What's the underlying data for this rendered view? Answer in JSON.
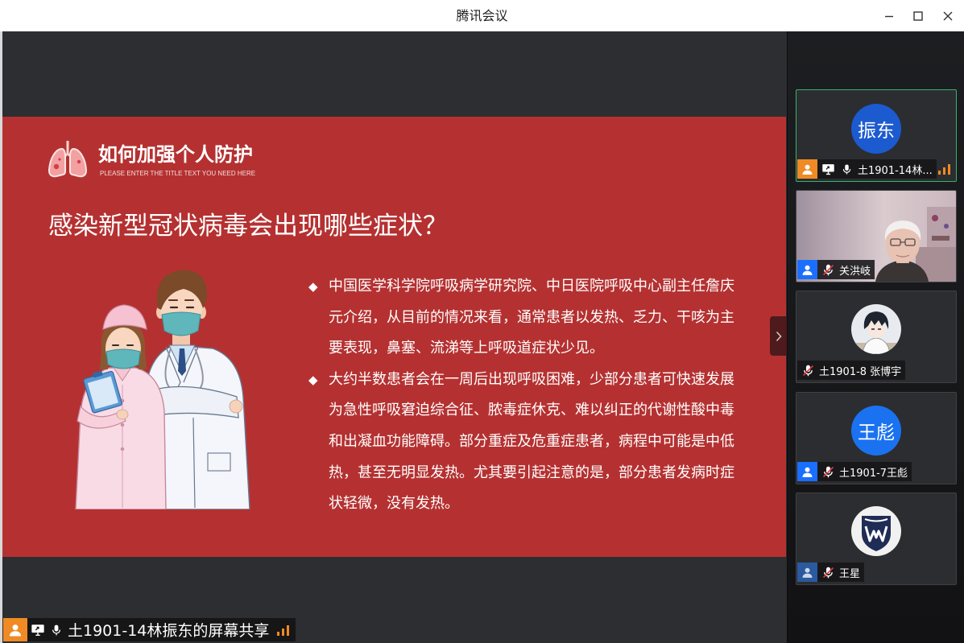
{
  "window": {
    "title": "腾讯会议",
    "minimize_icon": "minimize-icon",
    "maximize_icon": "maximize-icon",
    "close_icon": "close-icon"
  },
  "share": {
    "presenter_label": "土1901-14林振东的屏幕共享",
    "presenter_badge_color": "#f08a24",
    "collapse_icon": "chevron-right-icon",
    "slide": {
      "background_color": "#b53131",
      "header_icon": "lungs-icon",
      "header_title": "如何加强个人防护",
      "header_subtitle": "PLEASE ENTER THE TITLE TEXT YOU NEED HERE",
      "heading": "感染新型冠状病毒会出现哪些症状？",
      "bullet_marker": "◆",
      "bullets": [
        {
          "lines": [
            "中国医学科学院呼吸病学研究院、中日医院呼吸中心副主任詹庆",
            "元介绍，从目前的情况来看，通常患者以发热、乏力、干咳为主",
            "要表现，鼻塞、流涕等上呼吸道症状少见。"
          ]
        },
        {
          "lines": [
            "大约半数患者会在一周后出现呼吸困难，少部分患者可快速发展",
            "为急性呼吸窘迫综合征、脓毒症休克、难以纠正的代谢性酸中毒",
            "和出凝血功能障碍。部分重症及危重症患者，病程中可能是中低",
            "热，甚至无明显发热。尤其要引起注意的是，部分患者发病时症",
            "状轻微，没有发热。"
          ]
        }
      ]
    }
  },
  "participants": [
    {
      "name": "土1901-14林...",
      "avatar_text": "振东",
      "avatar_color": "#1c5ad0",
      "badge_color": "#f08a24",
      "mic": "mic-on-icon",
      "share_icon": "screen-share-icon",
      "signal_icon": "signal-icon",
      "speaking": true
    },
    {
      "name": "关洪岐",
      "badge_color": "#1a6fff",
      "mic": "mic-muted-icon"
    },
    {
      "name": "土1901-8 张博宇",
      "mic": "mic-muted-icon",
      "avatar_image": "profile-photo-avatar"
    },
    {
      "name": "土1901-7王彪",
      "avatar_text": "王彪",
      "avatar_color": "#1a72f0",
      "badge_color": "#1a6fff",
      "mic": "mic-muted-icon"
    },
    {
      "name": "王星",
      "badge_color": "#2a5aa0",
      "mic": "mic-muted-icon",
      "avatar_image": "cw-logo-avatar"
    }
  ]
}
